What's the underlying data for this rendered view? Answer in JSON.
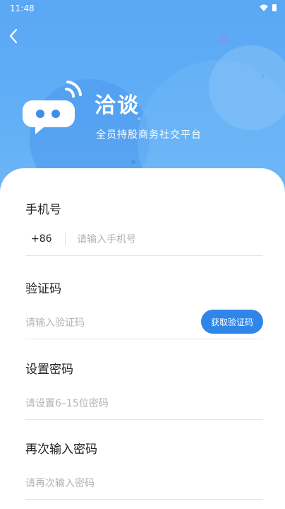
{
  "status_bar": {
    "time": "11:48"
  },
  "header": {
    "app_name": "洽谈",
    "slogan": "全员持股商务社交平台",
    "back_icon": "chevron-left-icon",
    "logo_icon": "chat-bubble-signal-icon"
  },
  "form": {
    "phone": {
      "label": "手机号",
      "country_code": "+86",
      "placeholder": "请输入手机号"
    },
    "code": {
      "label": "验证码",
      "placeholder": "请输入验证码",
      "button_label": "获取验证码"
    },
    "password": {
      "label": "设置密码",
      "placeholder": "请设置6–15位密码"
    },
    "confirm_password": {
      "label": "再次输入密码",
      "placeholder": "请再次输入密码"
    }
  },
  "colors": {
    "header_gradient_top": "#5aa8f4",
    "accent": "#2f86e8",
    "placeholder": "#b3b3b3",
    "text": "#222222"
  }
}
